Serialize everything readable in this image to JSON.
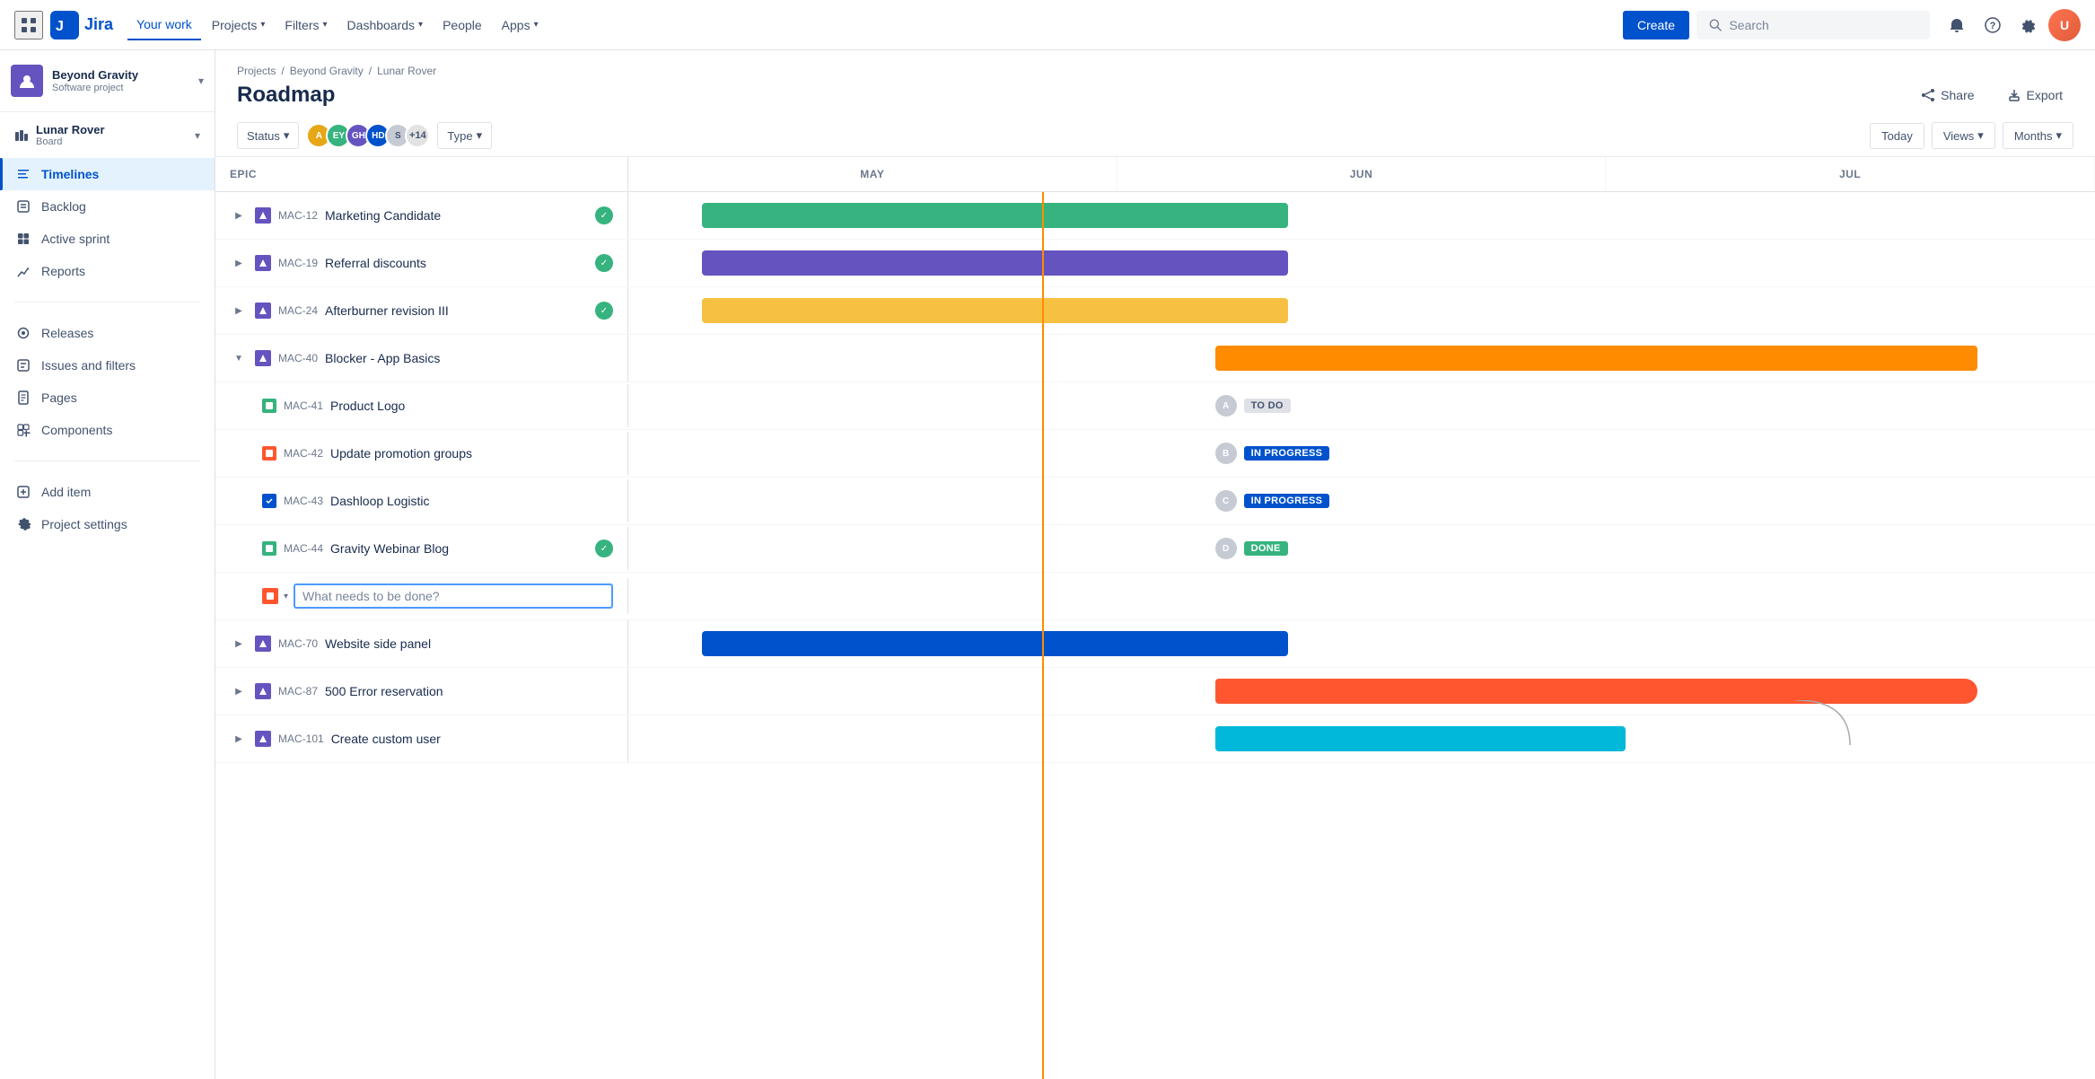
{
  "app": {
    "name": "Jira",
    "logo_text": "Jira"
  },
  "topnav": {
    "apps_label": "Apps",
    "your_work": "Your work",
    "projects": "Projects",
    "filters": "Filters",
    "dashboards": "Dashboards",
    "people": "People",
    "apps": "Apps",
    "create": "Create",
    "search_placeholder": "Search"
  },
  "sidebar": {
    "project_name": "Beyond Gravity",
    "project_type": "Software project",
    "board_name": "Lunar Rover",
    "board_type": "Board",
    "items": [
      {
        "id": "timelines",
        "label": "Timelines",
        "active": true
      },
      {
        "id": "backlog",
        "label": "Backlog",
        "active": false
      },
      {
        "id": "active-sprint",
        "label": "Active sprint",
        "active": false
      },
      {
        "id": "reports",
        "label": "Reports",
        "active": false
      },
      {
        "id": "releases",
        "label": "Releases",
        "active": false
      },
      {
        "id": "issues-filters",
        "label": "Issues and filters",
        "active": false
      },
      {
        "id": "pages",
        "label": "Pages",
        "active": false
      },
      {
        "id": "components",
        "label": "Components",
        "active": false
      },
      {
        "id": "add-item",
        "label": "Add item",
        "active": false
      },
      {
        "id": "project-settings",
        "label": "Project settings",
        "active": false
      }
    ]
  },
  "breadcrumb": {
    "projects": "Projects",
    "project": "Beyond Gravity",
    "board": "Lunar Rover"
  },
  "page": {
    "title": "Roadmap",
    "share_label": "Share",
    "export_label": "Export"
  },
  "toolbar": {
    "status_label": "Status",
    "type_label": "Type",
    "today_label": "Today",
    "views_label": "Views",
    "months_label": "Months",
    "avatar_extra": "+14"
  },
  "roadmap": {
    "epic_col": "Epic",
    "months": [
      "MAY",
      "JUN",
      "JUL"
    ],
    "epics": [
      {
        "id": "MAC-12",
        "name": "Marketing Candidate",
        "has_children": true,
        "expanded": false,
        "status": "done",
        "bar_color": "green",
        "bar_left_pct": 5,
        "bar_width_pct": 38
      },
      {
        "id": "MAC-19",
        "name": "Referral discounts",
        "has_children": true,
        "expanded": false,
        "status": "done",
        "bar_color": "purple",
        "bar_left_pct": 5,
        "bar_width_pct": 38
      },
      {
        "id": "MAC-24",
        "name": "Afterburner revision III",
        "has_children": true,
        "expanded": false,
        "status": "done",
        "bar_color": "yellow",
        "bar_left_pct": 5,
        "bar_width_pct": 38
      },
      {
        "id": "MAC-40",
        "name": "Blocker - App Basics",
        "has_children": true,
        "expanded": true,
        "status": "",
        "bar_color": "orange",
        "bar_left_pct": 38,
        "bar_width_pct": 55,
        "children": [
          {
            "id": "MAC-41",
            "name": "Product Logo",
            "icon_color": "green",
            "timeline_status": "TO DO"
          },
          {
            "id": "MAC-42",
            "name": "Update promotion groups",
            "icon_color": "red",
            "timeline_status": "IN PROGRESS"
          },
          {
            "id": "MAC-43",
            "name": "Dashloop Logistic",
            "icon_color": "blue",
            "timeline_status": "IN PROGRESS"
          },
          {
            "id": "MAC-44",
            "name": "Gravity Webinar Blog",
            "icon_color": "green",
            "status": "done",
            "timeline_status": "DONE"
          }
        ]
      },
      {
        "id": "MAC-70",
        "name": "Website side panel",
        "has_children": true,
        "expanded": false,
        "status": "",
        "bar_color": "blue",
        "bar_left_pct": 5,
        "bar_width_pct": 38
      },
      {
        "id": "MAC-87",
        "name": "500 Error reservation",
        "has_children": true,
        "expanded": false,
        "status": "",
        "bar_color": "coral",
        "bar_left_pct": 38,
        "bar_width_pct": 50
      },
      {
        "id": "MAC-101",
        "name": "Create custom user",
        "has_children": true,
        "expanded": false,
        "status": "",
        "bar_color": "cyan",
        "bar_left_pct": 38,
        "bar_width_pct": 28
      }
    ],
    "input_placeholder": "What needs to be done?"
  }
}
